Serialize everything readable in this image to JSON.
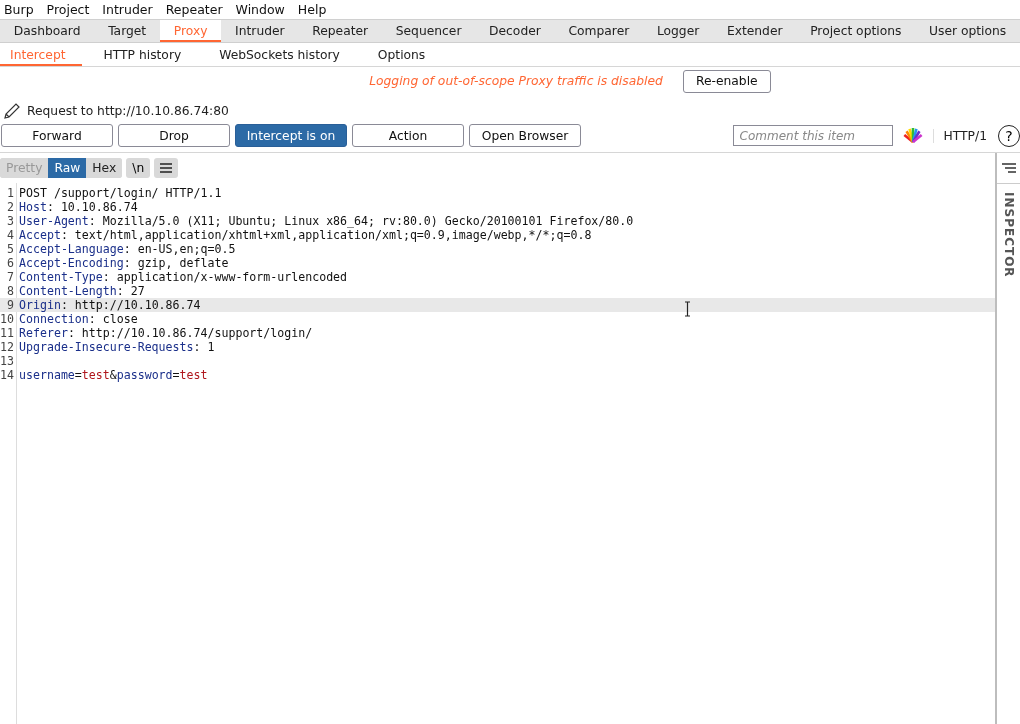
{
  "menu": [
    "Burp",
    "Project",
    "Intruder",
    "Repeater",
    "Window",
    "Help"
  ],
  "tabs": [
    {
      "label": "Dashboard",
      "selected": false
    },
    {
      "label": "Target",
      "selected": false
    },
    {
      "label": "Proxy",
      "selected": true
    },
    {
      "label": "Intruder",
      "selected": false
    },
    {
      "label": "Repeater",
      "selected": false
    },
    {
      "label": "Sequencer",
      "selected": false
    },
    {
      "label": "Decoder",
      "selected": false
    },
    {
      "label": "Comparer",
      "selected": false
    },
    {
      "label": "Logger",
      "selected": false
    },
    {
      "label": "Extender",
      "selected": false
    },
    {
      "label": "Project options",
      "selected": false
    },
    {
      "label": "User options",
      "selected": false
    }
  ],
  "subtabs": [
    {
      "label": "Intercept",
      "selected": true
    },
    {
      "label": "HTTP history",
      "selected": false
    },
    {
      "label": "WebSockets history",
      "selected": false
    },
    {
      "label": "Options",
      "selected": false
    }
  ],
  "notice": {
    "text": "Logging of out-of-scope Proxy traffic is disabled",
    "button": "Re-enable"
  },
  "request_label": "Request to http://10.10.86.74:80",
  "actions": [
    {
      "label": "Forward",
      "on": false
    },
    {
      "label": "Drop",
      "on": false
    },
    {
      "label": "Intercept is on",
      "on": true
    },
    {
      "label": "Action",
      "on": false
    },
    {
      "label": "Open Browser",
      "on": false
    }
  ],
  "comment": {
    "placeholder": "Comment this item"
  },
  "protocol": "HTTP/1",
  "help": "?",
  "view_tabs": [
    {
      "label": "Pretty",
      "selected": false,
      "disabled": true
    },
    {
      "label": "Raw",
      "selected": true,
      "disabled": false
    },
    {
      "label": "Hex",
      "selected": false,
      "disabled": false
    }
  ],
  "newline_toggle": "\\n",
  "lines": [
    {
      "number": "1",
      "highlighted": false,
      "parts": [
        {
          "kind": "text",
          "text": "POST /support/login/ HTTP/1.1"
        }
      ]
    },
    {
      "number": "2",
      "highlighted": false,
      "parts": [
        {
          "kind": "name",
          "text": "Host"
        },
        {
          "kind": "text",
          "text": ": 10.10.86.74"
        }
      ]
    },
    {
      "number": "3",
      "highlighted": false,
      "parts": [
        {
          "kind": "name",
          "text": "User-Agent"
        },
        {
          "kind": "text",
          "text": ": Mozilla/5.0 (X11; Ubuntu; Linux x86_64; rv:80.0) Gecko/20100101 Firefox/80.0"
        }
      ]
    },
    {
      "number": "4",
      "highlighted": false,
      "parts": [
        {
          "kind": "name",
          "text": "Accept"
        },
        {
          "kind": "text",
          "text": ": text/html,application/xhtml+xml,application/xml;q=0.9,image/webp,*/*;q=0.8"
        }
      ]
    },
    {
      "number": "5",
      "highlighted": false,
      "parts": [
        {
          "kind": "name",
          "text": "Accept-Language"
        },
        {
          "kind": "text",
          "text": ": en-US,en;q=0.5"
        }
      ]
    },
    {
      "number": "6",
      "highlighted": false,
      "parts": [
        {
          "kind": "name",
          "text": "Accept-Encoding"
        },
        {
          "kind": "text",
          "text": ": gzip, deflate"
        }
      ]
    },
    {
      "number": "7",
      "highlighted": false,
      "parts": [
        {
          "kind": "name",
          "text": "Content-Type"
        },
        {
          "kind": "text",
          "text": ": application/x-www-form-urlencoded"
        }
      ]
    },
    {
      "number": "8",
      "highlighted": false,
      "parts": [
        {
          "kind": "name",
          "text": "Content-Length"
        },
        {
          "kind": "text",
          "text": ": 27"
        }
      ]
    },
    {
      "number": "9",
      "highlighted": true,
      "parts": [
        {
          "kind": "name",
          "text": "Origin"
        },
        {
          "kind": "text",
          "text": ": http://10.10.86.74"
        }
      ]
    },
    {
      "number": "10",
      "highlighted": false,
      "parts": [
        {
          "kind": "name",
          "text": "Connection"
        },
        {
          "kind": "text",
          "text": ": close"
        }
      ]
    },
    {
      "number": "11",
      "highlighted": false,
      "parts": [
        {
          "kind": "name",
          "text": "Referer"
        },
        {
          "kind": "text",
          "text": ": http://10.10.86.74/support/login/"
        }
      ]
    },
    {
      "number": "12",
      "highlighted": false,
      "parts": [
        {
          "kind": "name",
          "text": "Upgrade-Insecure-Requests"
        },
        {
          "kind": "text",
          "text": ": 1"
        }
      ]
    },
    {
      "number": "13",
      "highlighted": false
    },
    {
      "number": "14",
      "highlighted": false,
      "parts": [
        {
          "kind": "name",
          "text": "username"
        },
        {
          "kind": "symbol",
          "text": "="
        },
        {
          "kind": "value",
          "text": "test"
        },
        {
          "kind": "symbol",
          "text": "&"
        },
        {
          "kind": "name",
          "text": "password"
        },
        {
          "kind": "symbol",
          "text": "="
        },
        {
          "kind": "value",
          "text": "test"
        }
      ]
    }
  ],
  "inspector": "INSPECTOR"
}
